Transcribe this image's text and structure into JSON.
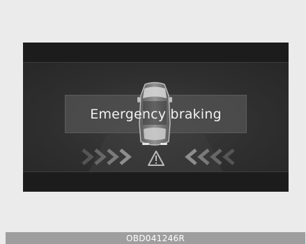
{
  "cluster_display": {
    "message": "Emergency braking",
    "icons": {
      "vehicle": "car-top-view-icon",
      "warning": "warning-triangle-icon",
      "approach_left": "chevrons-right-icon",
      "approach_right": "chevrons-left-icon"
    },
    "colors": {
      "screen": "#2a2a2a",
      "message_text": "#f2f2f2",
      "message_box": "#525252"
    }
  },
  "figure": {
    "code": "OBD041246R"
  }
}
